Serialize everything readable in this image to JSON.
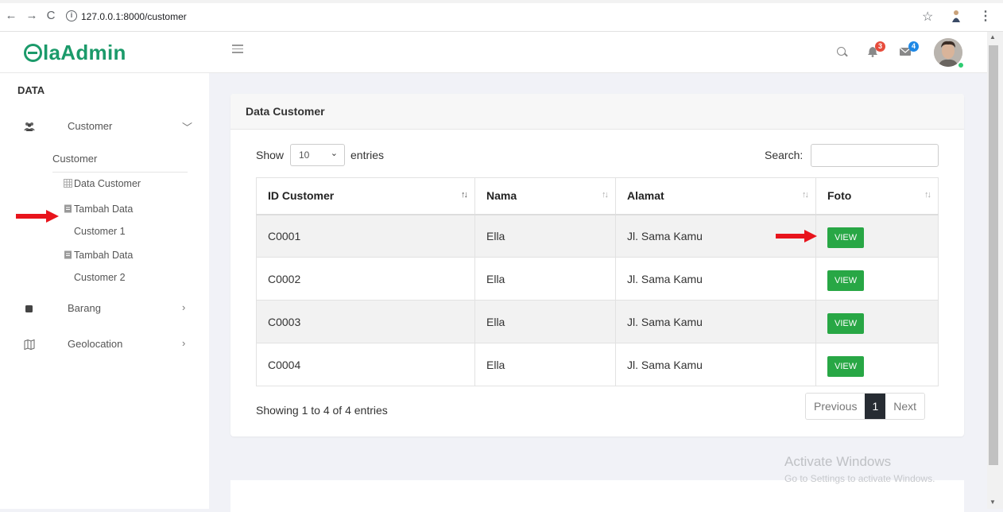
{
  "browser": {
    "url": "127.0.0.1:8000/customer"
  },
  "brand": {
    "logo_text": "laAdmin",
    "accent": "#1b9a6a"
  },
  "sidebar": {
    "section_title": "DATA",
    "items": [
      {
        "label": "Customer",
        "icon": "users-icon",
        "chevron": "chevron-down-icon"
      },
      {
        "label": "Barang",
        "icon": "square-icon",
        "chevron": "chevron-right-icon"
      },
      {
        "label": "Geolocation",
        "icon": "map-icon",
        "chevron": "chevron-right-icon"
      }
    ],
    "submenu_title": "Customer",
    "submenu": [
      {
        "label": "Data Customer",
        "icon": "table-icon"
      },
      {
        "label_line1": "Tambah Data",
        "label_line2": "Customer 1",
        "icon": "file-icon"
      },
      {
        "label_line1": "Tambah Data",
        "label_line2": "Customer 2",
        "icon": "file-icon"
      }
    ]
  },
  "header": {
    "notifications_count": "3",
    "messages_count": "4",
    "notification_badge_color": "#e74c3c",
    "message_badge_color": "#1e88e5"
  },
  "card": {
    "title": "Data Customer",
    "show_label": "Show",
    "page_length": "10",
    "entries_label": "entries",
    "search_label": "Search:",
    "search_value": "",
    "columns": [
      "ID Customer",
      "Nama",
      "Alamat",
      "Foto"
    ],
    "rows": [
      {
        "id": "C0001",
        "nama": "Ella",
        "alamat": "Jl. Sama Kamu",
        "foto_button": "VIEW"
      },
      {
        "id": "C0002",
        "nama": "Ella",
        "alamat": "Jl. Sama Kamu",
        "foto_button": "VIEW"
      },
      {
        "id": "C0003",
        "nama": "Ella",
        "alamat": "Jl. Sama Kamu",
        "foto_button": "VIEW"
      },
      {
        "id": "C0004",
        "nama": "Ella",
        "alamat": "Jl. Sama Kamu",
        "foto_button": "VIEW"
      }
    ],
    "info": "Showing 1 to 4 of 4 entries",
    "pagination": {
      "previous": "Previous",
      "current": "1",
      "next": "Next"
    }
  },
  "watermark": {
    "line1": "Activate Windows",
    "line2": "Go to Settings to activate Windows."
  }
}
